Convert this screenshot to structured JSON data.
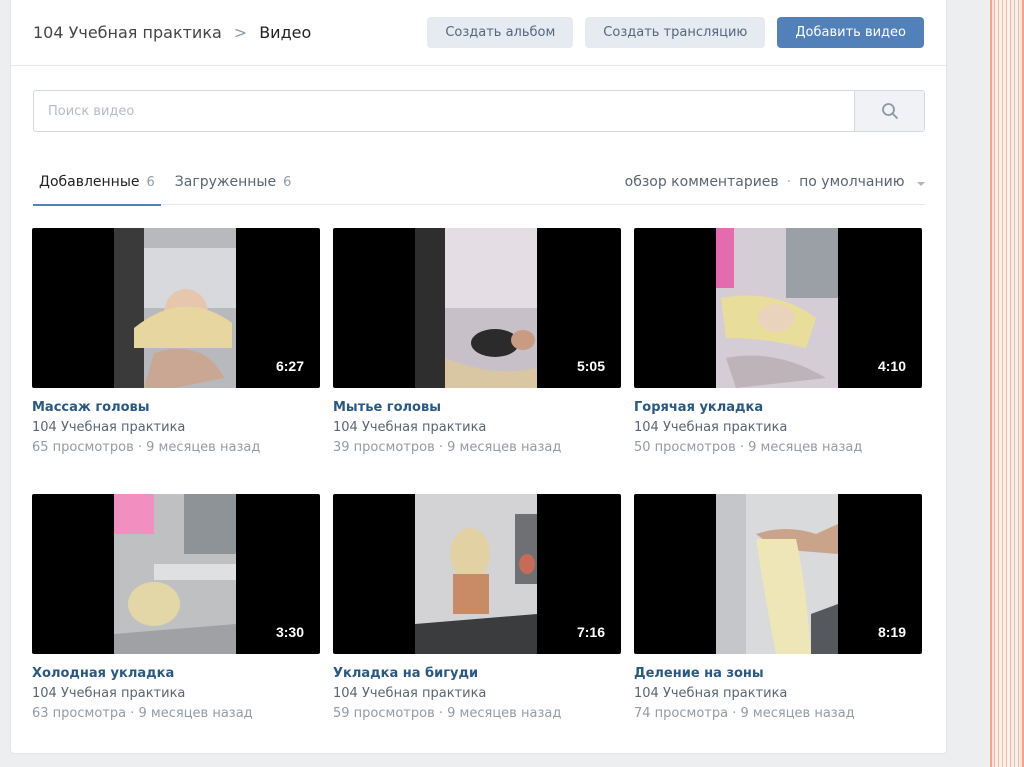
{
  "breadcrumb": {
    "group": "104 Учебная практика",
    "separator": ">",
    "current": "Видео"
  },
  "buttons": {
    "create_album": "Создать альбом",
    "create_stream": "Создать трансляцию",
    "add_video": "Добавить видео"
  },
  "search": {
    "placeholder": "Поиск видео",
    "icon": "search-icon"
  },
  "tabs": [
    {
      "label": "Добавленные",
      "count": "6"
    },
    {
      "label": "Загруженные",
      "count": "6"
    }
  ],
  "tabs_right": {
    "comments": "обзор комментариев",
    "separator": "·",
    "sort": "по умолчанию"
  },
  "colors": {
    "accent": "#5181b8",
    "link": "#2a5885",
    "muted": "#939ba4"
  },
  "videos": [
    {
      "title": "Массаж головы",
      "owner": "104 Учебная практика",
      "views": "65 просмотров",
      "sep": "·",
      "age": "9 месяцев назад",
      "duration": "6:27"
    },
    {
      "title": "Мытье головы",
      "owner": "104 Учебная практика",
      "views": "39 просмотров",
      "sep": "·",
      "age": "9 месяцев назад",
      "duration": "5:05"
    },
    {
      "title": "Горячая укладка",
      "owner": "104 Учебная практика",
      "views": "50 просмотров",
      "sep": "·",
      "age": "9 месяцев назад",
      "duration": "4:10"
    },
    {
      "title": "Холодная укладка",
      "owner": "104 Учебная практика",
      "views": "63 просмотра",
      "sep": "·",
      "age": "9 месяцев назад",
      "duration": "3:30"
    },
    {
      "title": "Укладка на бигуди",
      "owner": "104 Учебная практика",
      "views": "59 просмотров",
      "sep": "·",
      "age": "9 месяцев назад",
      "duration": "7:16"
    },
    {
      "title": "Деление на зоны",
      "owner": "104 Учебная практика",
      "views": "74 просмотра",
      "sep": "·",
      "age": "9 месяцев назад",
      "duration": "8:19"
    }
  ]
}
